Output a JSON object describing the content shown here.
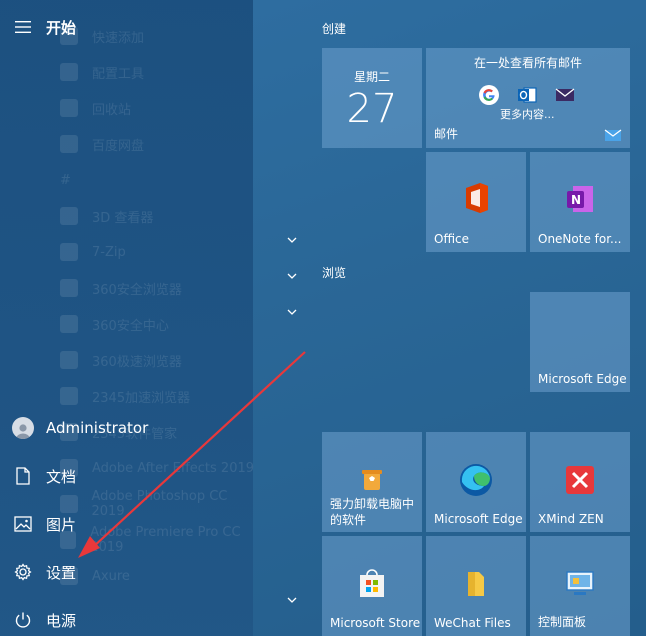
{
  "rail": {
    "title": "开始",
    "ghost_items": [
      "快速添加",
      "配置工具",
      "回收站",
      "百度网盘",
      "#",
      "3D 查看器",
      "7-Zip",
      "360安全浏览器",
      "360安全中心",
      "360极速浏览器",
      "2345加速浏览器",
      "2345软件管家",
      "Adobe After Effects 2019",
      "Adobe Photoshop CC 2019",
      "Adobe Premiere Pro CC 2019",
      "Axure"
    ],
    "user": "Administrator",
    "documents": "文档",
    "pictures": "图片",
    "settings": "设置",
    "power": "电源"
  },
  "groups": {
    "create": "创建",
    "browse": "浏览"
  },
  "tiles": {
    "calendar_day": "星期二",
    "calendar_date": "27",
    "mail_header": "在一处查看所有邮件",
    "mail_more": "更多内容...",
    "mail_label": "邮件",
    "office": "Office",
    "onenote": "OneNote for...",
    "edge_browse": "Microsoft Edge",
    "uninstall_line1": "强力卸载电脑中",
    "uninstall_line2": "的软件",
    "edge2": "Microsoft Edge",
    "xmind": "XMind ZEN",
    "store": "Microsoft Store",
    "wechat": "WeChat Files",
    "control": "控制面板"
  },
  "colors": {
    "background": "#2a6797",
    "tile": "#6ea0cd",
    "arrow": "#e8383b"
  }
}
